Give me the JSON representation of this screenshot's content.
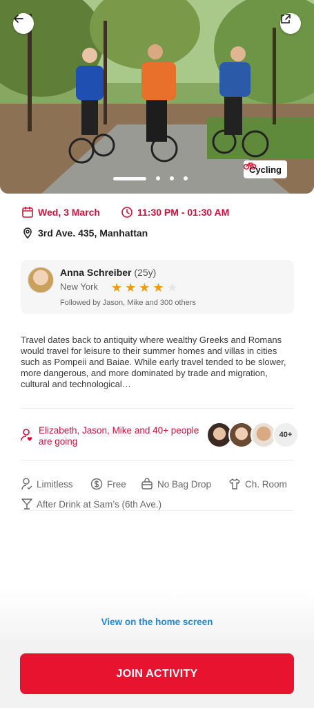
{
  "hero": {
    "category_tag": "Cycling"
  },
  "event": {
    "date": "Wed, 3 March",
    "time": "11:30 PM - 01:30 AM",
    "address": "3rd Ave. 435, Manhattan"
  },
  "host": {
    "name": "Anna Schreiber",
    "age": "(25y)",
    "city": "New York",
    "rating": 4,
    "rating_max": 5,
    "followers": "Followed by Jason, Mike and 300 others"
  },
  "description": "Travel dates back to antiquity where wealthy Greeks and Romans would travel for leisure to their summer homes and villas in cities such as Pompeii and Baiae. While early travel tended to be slower, more dangerous, and more dominated by trade and migration, cultural and technological…",
  "attendees": {
    "text": "Elizabeth, Jason, Mike and 40+ people are going",
    "more_count": "40+"
  },
  "amenities": [
    {
      "label": "Limitless",
      "icon": "person-check-icon"
    },
    {
      "label": "Free",
      "icon": "dollar-coin-icon"
    },
    {
      "label": "No Bag Drop",
      "icon": "bag-icon"
    },
    {
      "label": "Ch. Room",
      "icon": "shirt-icon"
    },
    {
      "label": "After Drink at Sam’s (6th Ave.)",
      "icon": "cocktail-icon"
    }
  ],
  "links": {
    "view_home": "View on the home screen"
  },
  "actions": {
    "join": "JOIN ACTIVITY"
  },
  "colors": {
    "accent": "#e8132f",
    "accent_text": "#d0103a",
    "link": "#1f8ad6",
    "star": "#f09a12"
  }
}
